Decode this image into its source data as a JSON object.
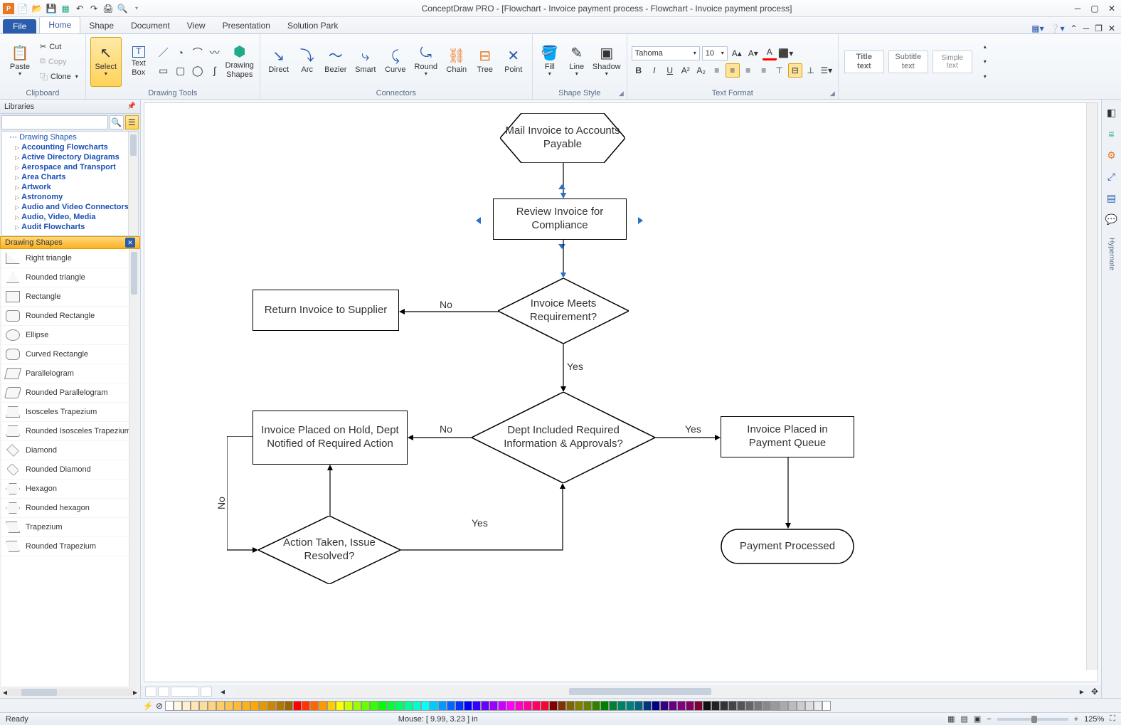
{
  "titlebar": {
    "title": "ConceptDraw PRO - [Flowchart - Invoice payment process - Flowchart - Invoice payment process]"
  },
  "tabs": {
    "file": "File",
    "list": [
      "Home",
      "Shape",
      "Document",
      "View",
      "Presentation",
      "Solution Park"
    ],
    "active": 0
  },
  "ribbon": {
    "clipboard": {
      "paste": "Paste",
      "cut": "Cut",
      "copy": "Copy",
      "clone": "Clone",
      "label": "Clipboard"
    },
    "drawtools": {
      "select": "Select",
      "textbox": "Text\nBox",
      "drawshapes": "Drawing\nShapes",
      "label": "Drawing Tools"
    },
    "connectors": {
      "direct": "Direct",
      "arc": "Arc",
      "bezier": "Bezier",
      "smart": "Smart",
      "curve": "Curve",
      "round": "Round",
      "chain": "Chain",
      "tree": "Tree",
      "point": "Point",
      "label": "Connectors"
    },
    "shapestyle": {
      "fill": "Fill",
      "line": "Line",
      "shadow": "Shadow",
      "label": "Shape Style"
    },
    "textformat": {
      "font": "Tahoma",
      "size": "10",
      "label": "Text Format"
    },
    "textstyle": {
      "title": "Title\ntext",
      "subtitle": "Subtitle\ntext",
      "simple": "Simple\ntext"
    }
  },
  "libraries": {
    "header": "Libraries",
    "treeHeader": "Drawing Shapes",
    "tree": [
      "Accounting Flowcharts",
      "Active Directory Diagrams",
      "Aerospace and Transport",
      "Area Charts",
      "Artwork",
      "Astronomy",
      "Audio and Video Connectors",
      "Audio, Video, Media",
      "Audit Flowcharts"
    ],
    "category": "Drawing Shapes",
    "shapes": [
      "Right triangle",
      "Rounded triangle",
      "Rectangle",
      "Rounded Rectangle",
      "Ellipse",
      "Curved Rectangle",
      "Parallelogram",
      "Rounded Parallelogram",
      "Isosceles Trapezium",
      "Rounded Isosceles Trapezium",
      "Diamond",
      "Rounded Diamond",
      "Hexagon",
      "Rounded hexagon",
      "Trapezium",
      "Rounded Trapezium"
    ]
  },
  "flowchart": {
    "n1": "Mail Invoice to Accounts Payable",
    "n2": "Review Invoice for Compliance",
    "n3": "Invoice Meets Requirement?",
    "n4": "Return Invoice to Supplier",
    "n5": "Dept Included Required Information & Approvals?",
    "n6": "Invoice Placed on Hold, Dept Notified of Required Action",
    "n7": "Invoice Placed in Payment Queue",
    "n8": "Action Taken, Issue Resolved?",
    "n9": "Payment Processed",
    "yes": "Yes",
    "no": "No"
  },
  "rstrip": {
    "hypernote": "Hypernote"
  },
  "colors": [
    "#ffffff",
    "#fff7e6",
    "#ffefcc",
    "#ffe6b3",
    "#ffdd99",
    "#ffd480",
    "#ffcc66",
    "#ffc34d",
    "#ffba33",
    "#ffb11a",
    "#ffa800",
    "#e69800",
    "#cc8700",
    "#b37600",
    "#996600",
    "#ff0000",
    "#ff3300",
    "#ff6600",
    "#ff9900",
    "#ffcc00",
    "#ffff00",
    "#ccff00",
    "#99ff00",
    "#66ff00",
    "#33ff00",
    "#00ff00",
    "#00ff33",
    "#00ff66",
    "#00ff99",
    "#00ffcc",
    "#00ffff",
    "#00ccff",
    "#0099ff",
    "#0066ff",
    "#0033ff",
    "#0000ff",
    "#3300ff",
    "#6600ff",
    "#9900ff",
    "#cc00ff",
    "#ff00ff",
    "#ff00cc",
    "#ff0099",
    "#ff0066",
    "#ff0033",
    "#800000",
    "#803300",
    "#806600",
    "#808000",
    "#668000",
    "#338000",
    "#008000",
    "#008033",
    "#008066",
    "#008080",
    "#006680",
    "#003380",
    "#000080",
    "#330080",
    "#660080",
    "#800080",
    "#800066",
    "#800033",
    "#111",
    "#222",
    "#333",
    "#444",
    "#555",
    "#666",
    "#777",
    "#888",
    "#999",
    "#aaa",
    "#bbb",
    "#ccc",
    "#ddd",
    "#eee",
    "#fff"
  ],
  "status": {
    "ready": "Ready",
    "mouse": "Mouse: [ 9.99, 3.23 ] in",
    "zoom": "125%"
  }
}
